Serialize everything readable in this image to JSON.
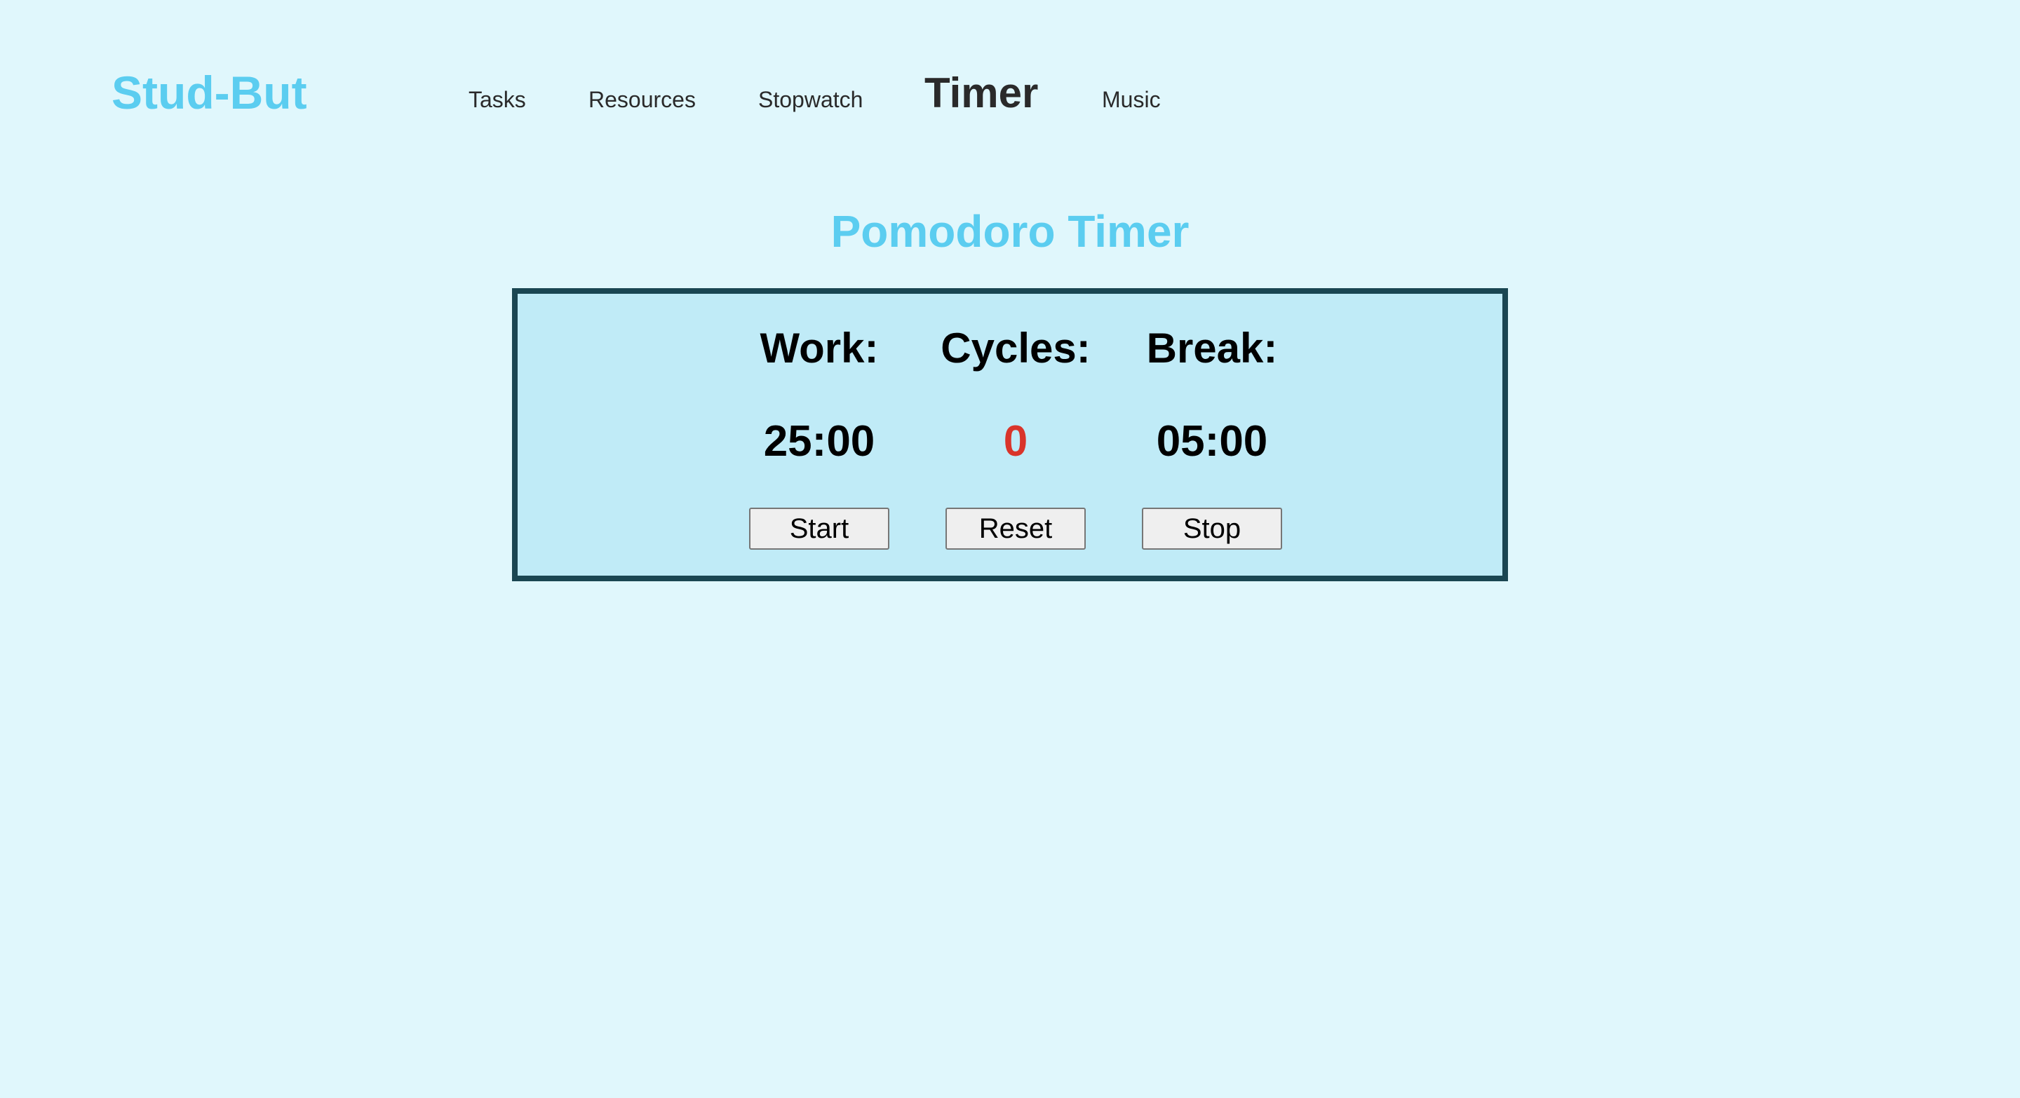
{
  "header": {
    "logo": "Stud-But",
    "nav": [
      {
        "label": "Tasks",
        "active": false
      },
      {
        "label": "Resources",
        "active": false
      },
      {
        "label": "Stopwatch",
        "active": false
      },
      {
        "label": "Timer",
        "active": true
      },
      {
        "label": "Music",
        "active": false
      }
    ]
  },
  "main": {
    "title": "Pomodoro Timer",
    "work": {
      "label": "Work:",
      "value": "25:00"
    },
    "cycles": {
      "label": "Cycles:",
      "value": "0"
    },
    "break": {
      "label": "Break:",
      "value": "05:00"
    },
    "buttons": {
      "start": "Start",
      "reset": "Reset",
      "stop": "Stop"
    }
  },
  "colors": {
    "background": "#e0f7fc",
    "accent": "#5bcdf0",
    "panel": "#c0ebf7",
    "panel_border": "#1a4652",
    "cycles_value": "#d9342a"
  }
}
